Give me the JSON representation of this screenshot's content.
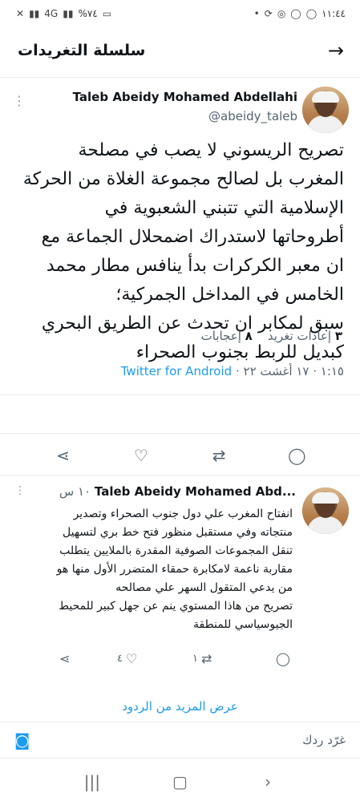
{
  "status_bar": {
    "time": "١١:٤٤",
    "battery": "%٧٤",
    "network": "4G"
  },
  "header": {
    "title": "سلسلة التغريدات"
  },
  "tweet": {
    "author_name": "Taleb Abeidy Mohamed Abdellahi",
    "handle": "@abeidy_taleb",
    "lines": [
      "تصريح الريسوني لا يصب في مصلحة",
      "المغرب بل لصالح مجموعة الغلاة من الحركة",
      "الإسلامية التي تتبني الشعبوية في",
      "أطروحاتها لاستدراك اضمحلال الجماعة مع",
      "ان معبر الكركرات بدأ ينافس مطار محمد",
      "الخامس في المداخل الجمركية؛",
      "سبق لمكابر ان تحدث عن الطريق البحري",
      "كبديل للربط بجنوب الصحراء"
    ],
    "time": "١:١٥",
    "date": "١٧ أغشت ٢٢",
    "source": "Twitter for Android",
    "retweets_count": "٣",
    "retweets_label": "إعادات تغريد",
    "likes_count": "٨",
    "likes_label": "إعجابات"
  },
  "reply": {
    "author_name": "Taleb Abeidy Mohamed Abd...",
    "time": "١٠ س",
    "lines": [
      "انفتاح المغرب علي دول جنوب الصحراء وتصدير",
      "منتجاته وفي مستقبل منظور فتح خط بري لتسهيل",
      "تنقل المجموعات الصوفية  المقدرة بالملايين يتطلب",
      "مقاربة ناعمة لامكابرة حمقاء المتضرر الأول منها هو",
      "من يدعي المتقول السهر علي مصالحه",
      "تصريح من هاذا المستوي ينم عن جهل كبير للمحيط",
      "الجيوسياسي للمنطقة"
    ],
    "likes_count": "٤",
    "retweets_count": "١"
  },
  "show_more": "عرض المزيد من الردود",
  "composer": {
    "placeholder": "غرّد ردك"
  }
}
